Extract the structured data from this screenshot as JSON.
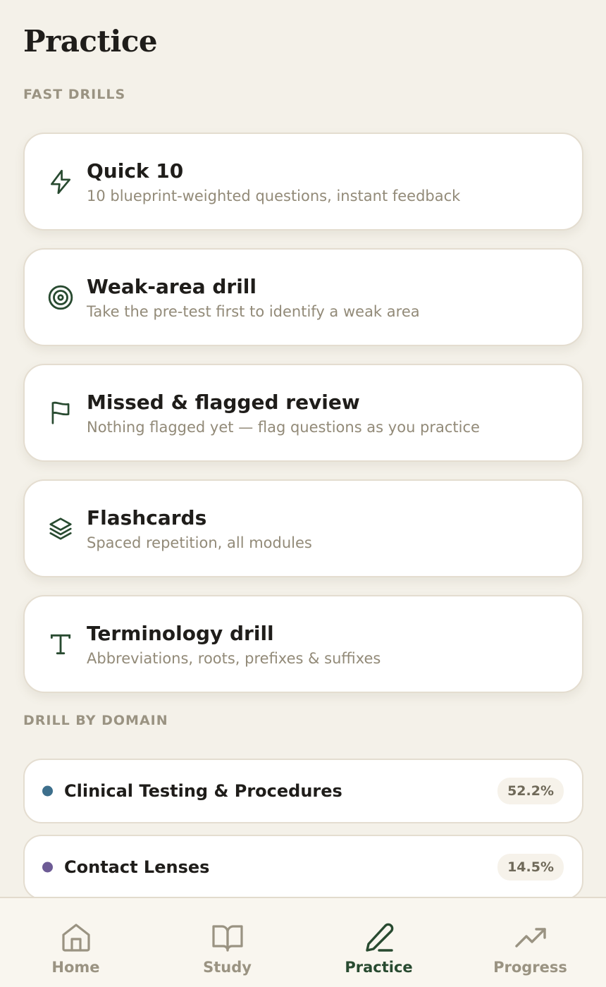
{
  "page": {
    "title": "Practice"
  },
  "sections": {
    "fast_drills": "FAST DRILLS",
    "drill_by_domain": "DRILL BY DOMAIN"
  },
  "drills": [
    {
      "title": "Quick 10",
      "subtitle": "10 blueprint-weighted questions, instant feedback",
      "icon": "lightning-icon"
    },
    {
      "title": "Weak-area drill",
      "subtitle": "Take the pre-test first to identify a weak area",
      "icon": "target-icon"
    },
    {
      "title": "Missed & flagged review",
      "subtitle": "Nothing flagged yet — flag questions as you practice",
      "icon": "flag-icon"
    },
    {
      "title": "Flashcards",
      "subtitle": "Spaced repetition, all modules",
      "icon": "layers-icon"
    },
    {
      "title": "Terminology drill",
      "subtitle": "Abbreviations, roots, prefixes & suffixes",
      "icon": "type-icon"
    }
  ],
  "domains": [
    {
      "name": "Clinical Testing & Procedures",
      "percent": "52.2%",
      "color": "#3d6f8c"
    },
    {
      "name": "Contact Lenses",
      "percent": "14.5%",
      "color": "#6d5b95"
    }
  ],
  "tabs": [
    {
      "label": "Home",
      "icon": "home-icon",
      "active": false
    },
    {
      "label": "Study",
      "icon": "book-icon",
      "active": false
    },
    {
      "label": "Practice",
      "icon": "pencil-icon",
      "active": true
    },
    {
      "label": "Progress",
      "icon": "trending-up-icon",
      "active": false
    }
  ],
  "colors": {
    "accent": "#284a30",
    "muted": "#9a9382",
    "background": "#f4f1e9"
  }
}
